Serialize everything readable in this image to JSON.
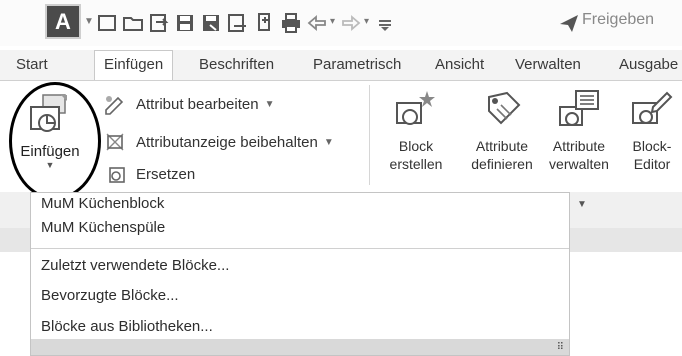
{
  "qat": {
    "app_letter": "A",
    "freigeben_label": "Freigeben",
    "icons": [
      "new-icon",
      "open-icon",
      "open-web-icon",
      "save-icon",
      "save-as-icon",
      "save-web-icon",
      "plot-icon",
      "print-icon",
      "undo-icon",
      "redo-icon",
      "customize-icon",
      "share-icon"
    ]
  },
  "tabs": [
    {
      "label": "Start"
    },
    {
      "label": "Einfügen"
    },
    {
      "label": "Beschriften"
    },
    {
      "label": "Parametrisch"
    },
    {
      "label": "Ansicht"
    },
    {
      "label": "Verwalten"
    },
    {
      "label": "Ausgabe"
    }
  ],
  "ribbon": {
    "einfuegen_label": "Einfügen",
    "commands": [
      {
        "label": "Attribut bearbeiten",
        "icon": "edit-attribute-icon"
      },
      {
        "label": "Attributanzeige beibehalten",
        "icon": "retain-attribute-display-icon"
      },
      {
        "label": "Ersetzen",
        "icon": "replace-icon"
      }
    ],
    "big_buttons": [
      {
        "line1": "Block",
        "line2": "erstellen",
        "icon": "create-block-icon"
      },
      {
        "line1": "Attribute",
        "line2": "definieren",
        "icon": "define-attributes-icon"
      },
      {
        "line1": "Attribute",
        "line2": "verwalten",
        "icon": "manage-attributes-icon"
      },
      {
        "line1": "Block-",
        "line2": "Editor",
        "icon": "block-editor-icon"
      }
    ]
  },
  "menu": {
    "blocks": [
      "MuM Küchenblock",
      "MuM Küchenspüle"
    ],
    "actions": [
      "Zuletzt verwendete Blöcke...",
      "Bevorzugte Blöcke...",
      "Blöcke aus Bibliotheken..."
    ]
  }
}
